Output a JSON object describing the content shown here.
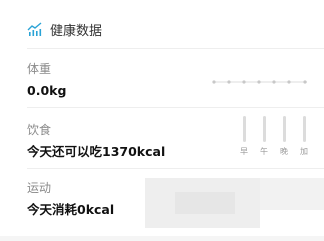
{
  "header": {
    "title": "健康数据",
    "icon": "chart-icon",
    "accent": "#2aa3d6"
  },
  "weight": {
    "label": "体重",
    "value": "0.0kg"
  },
  "diet": {
    "label": "饮食",
    "value": "今天还可以吃1370kcal",
    "meals": [
      "早",
      "午",
      "晚",
      "加"
    ]
  },
  "exercise": {
    "label": "运动",
    "value": "今天消耗0kcal"
  }
}
